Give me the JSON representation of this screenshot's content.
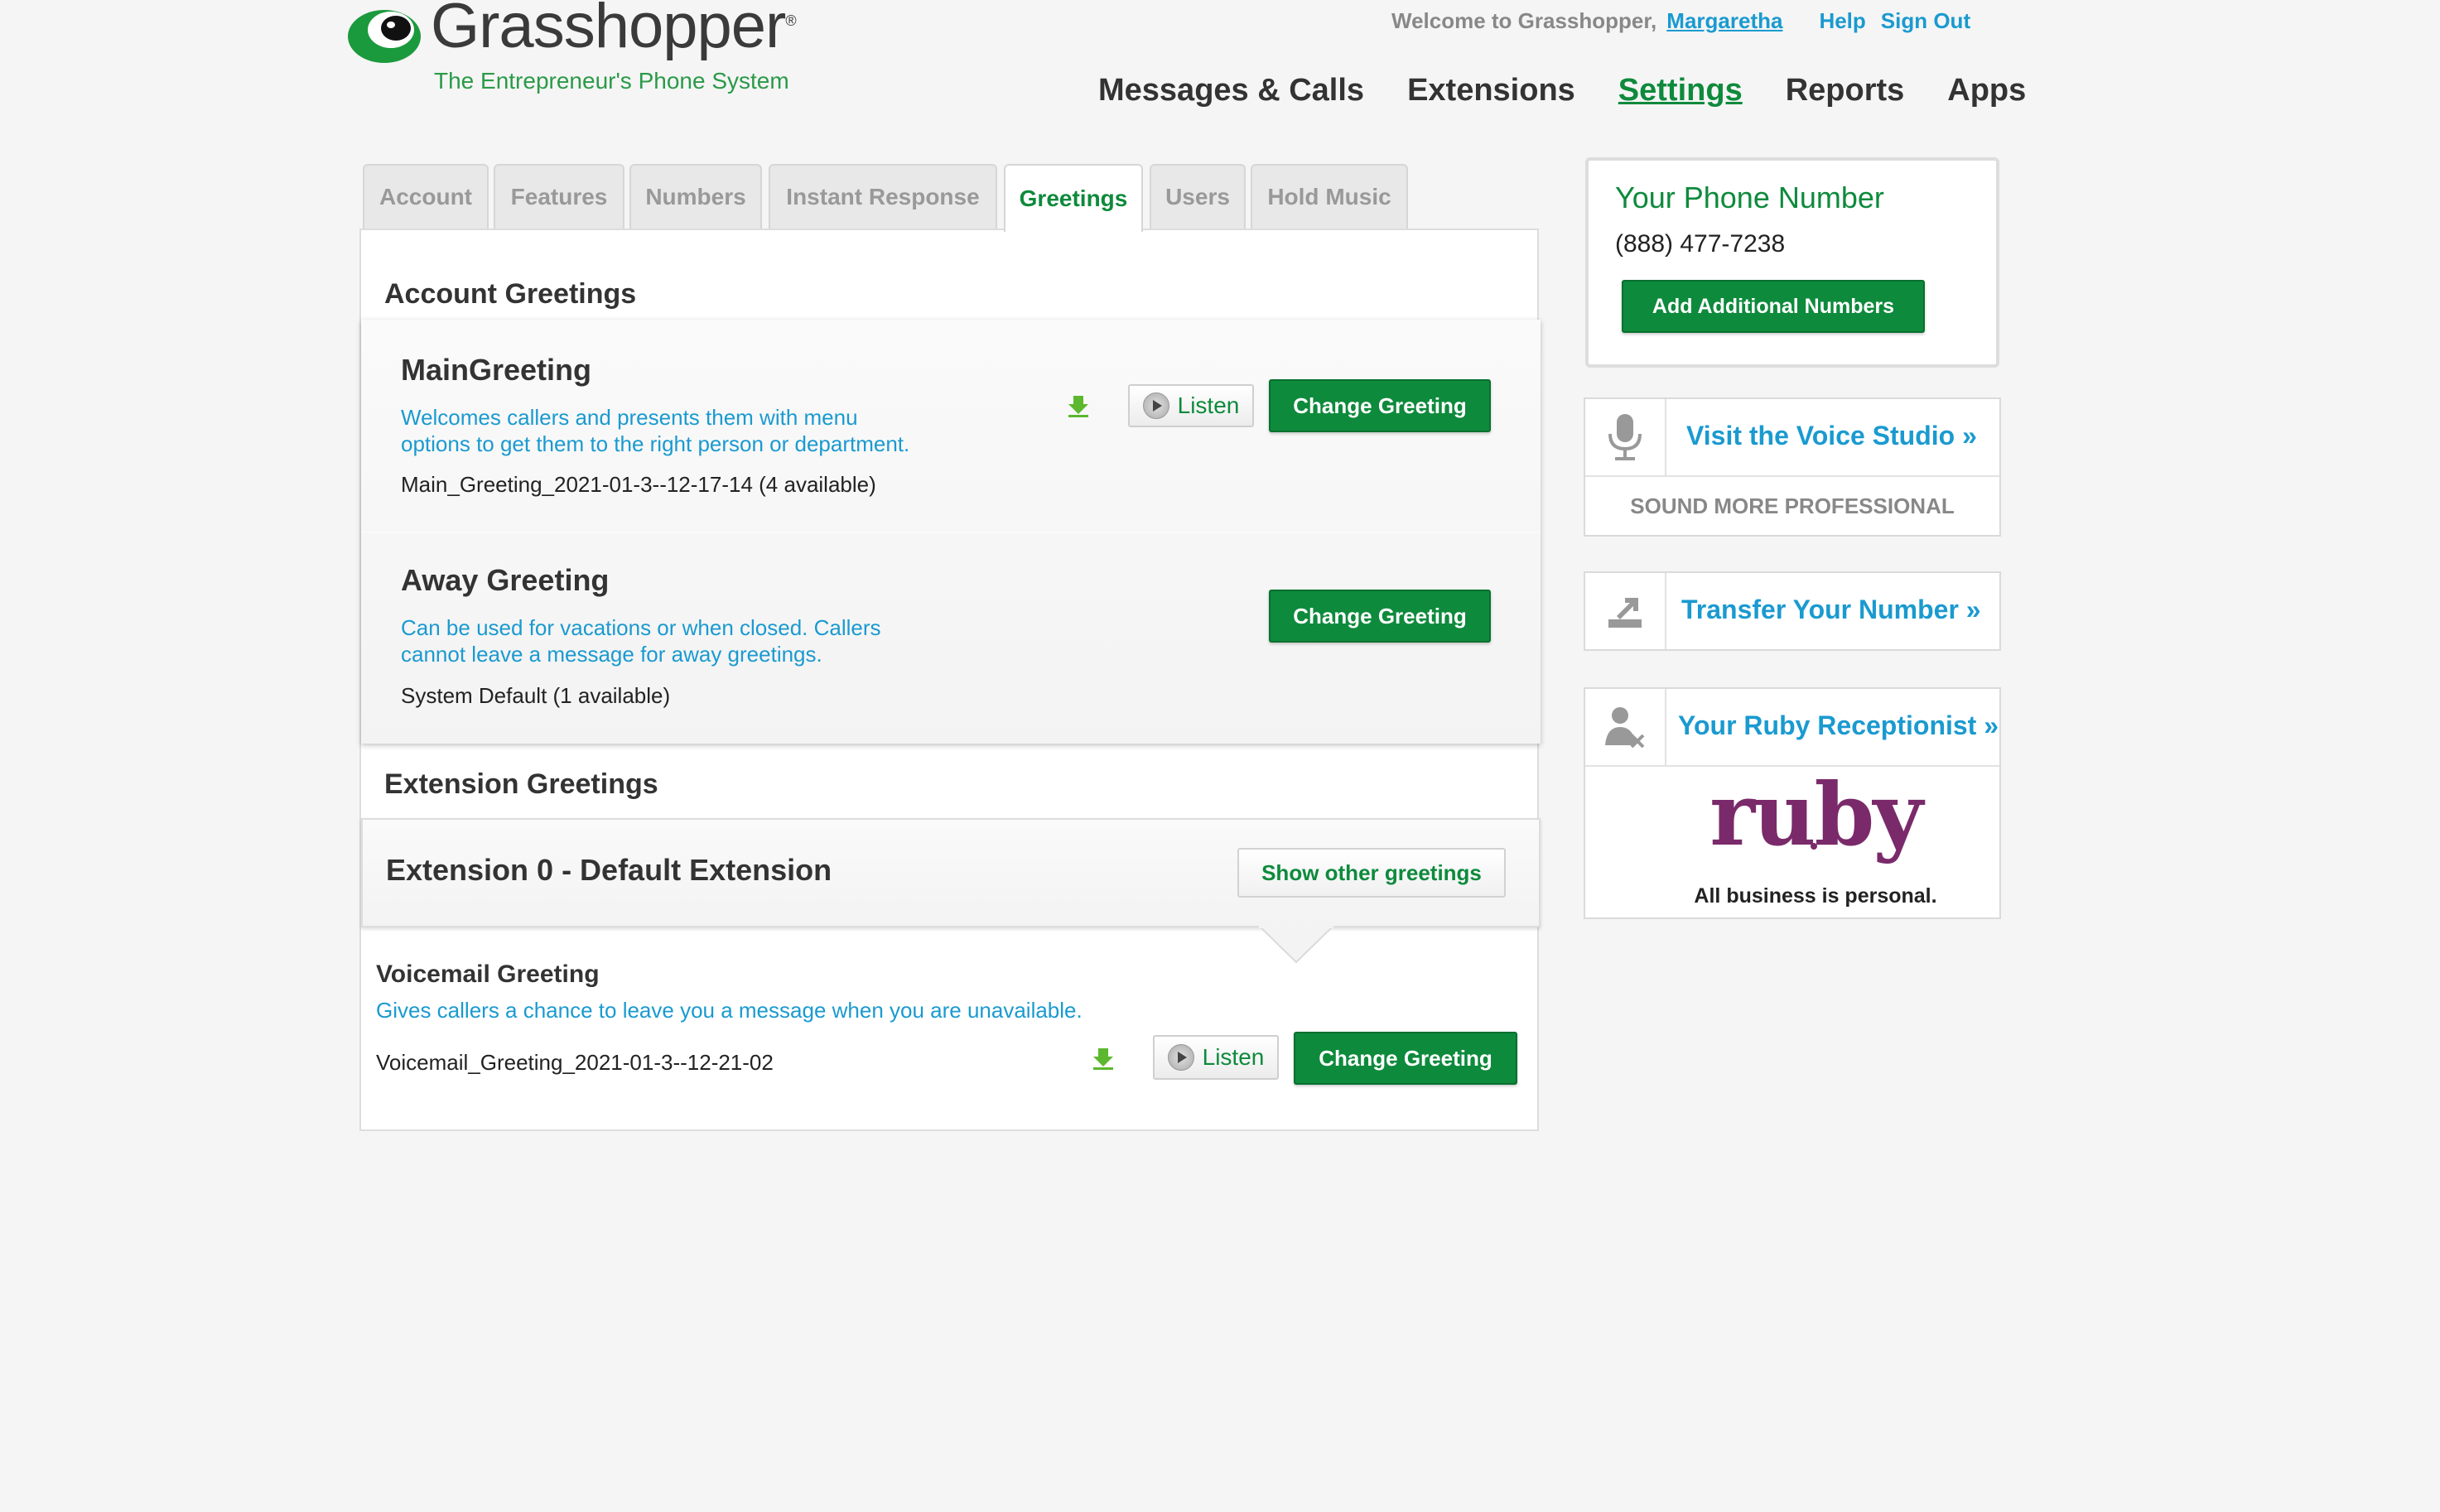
{
  "header": {
    "logo_text": "Grasshopper",
    "logo_reg": "®",
    "tagline": "The Entrepreneur's Phone System",
    "welcome": "Welcome to Grasshopper,",
    "user": "Margaretha",
    "help": "Help",
    "sign_out": "Sign Out"
  },
  "nav": {
    "items": [
      "Messages & Calls",
      "Extensions",
      "Settings",
      "Reports",
      "Apps"
    ],
    "active": "Settings"
  },
  "tabs": {
    "items": [
      "Account",
      "Features",
      "Numbers",
      "Instant Response",
      "Greetings",
      "Users",
      "Hold Music"
    ],
    "active": "Greetings"
  },
  "account_greetings": {
    "title": "Account Greetings",
    "main": {
      "name": "MainGreeting",
      "desc_line1": "Welcomes callers and presents them with menu",
      "desc_line2": "options to get them to the right person or department.",
      "file": "Main_Greeting_2021-01-3--12-17-14 (4 available)",
      "listen": "Listen",
      "change": "Change Greeting"
    },
    "away": {
      "name": "Away Greeting",
      "desc_line1": "Can be used for vacations or when closed. Callers",
      "desc_line2": "cannot leave a message for away greetings.",
      "file": "System Default (1 available)",
      "change": "Change Greeting"
    }
  },
  "extension_greetings": {
    "title": "Extension Greetings",
    "extension_name": "Extension 0 - Default Extension",
    "show_other": "Show other greetings",
    "voicemail": {
      "name": "Voicemail Greeting",
      "desc": "Gives callers a chance to leave you a message when you are unavailable.",
      "file": "Voicemail_Greeting_2021-01-3--12-21-02",
      "listen": "Listen",
      "change": "Change Greeting"
    }
  },
  "sidebar": {
    "phone_title": "Your Phone Number",
    "phone_number": "(888) 477-7238",
    "add_numbers": "Add Additional Numbers",
    "voice_studio": "Visit the Voice Studio »",
    "voice_studio_sub": "SOUND MORE PROFESSIONAL",
    "transfer": "Transfer Your Number »",
    "ruby": "Your Ruby Receptionist »",
    "ruby_logo": "ruby",
    "ruby_tagline": "All business is personal."
  },
  "colors": {
    "brand_green": "#0e8a3c",
    "link_blue": "#1a9ad0",
    "ruby_purple": "#7a2a6a"
  }
}
